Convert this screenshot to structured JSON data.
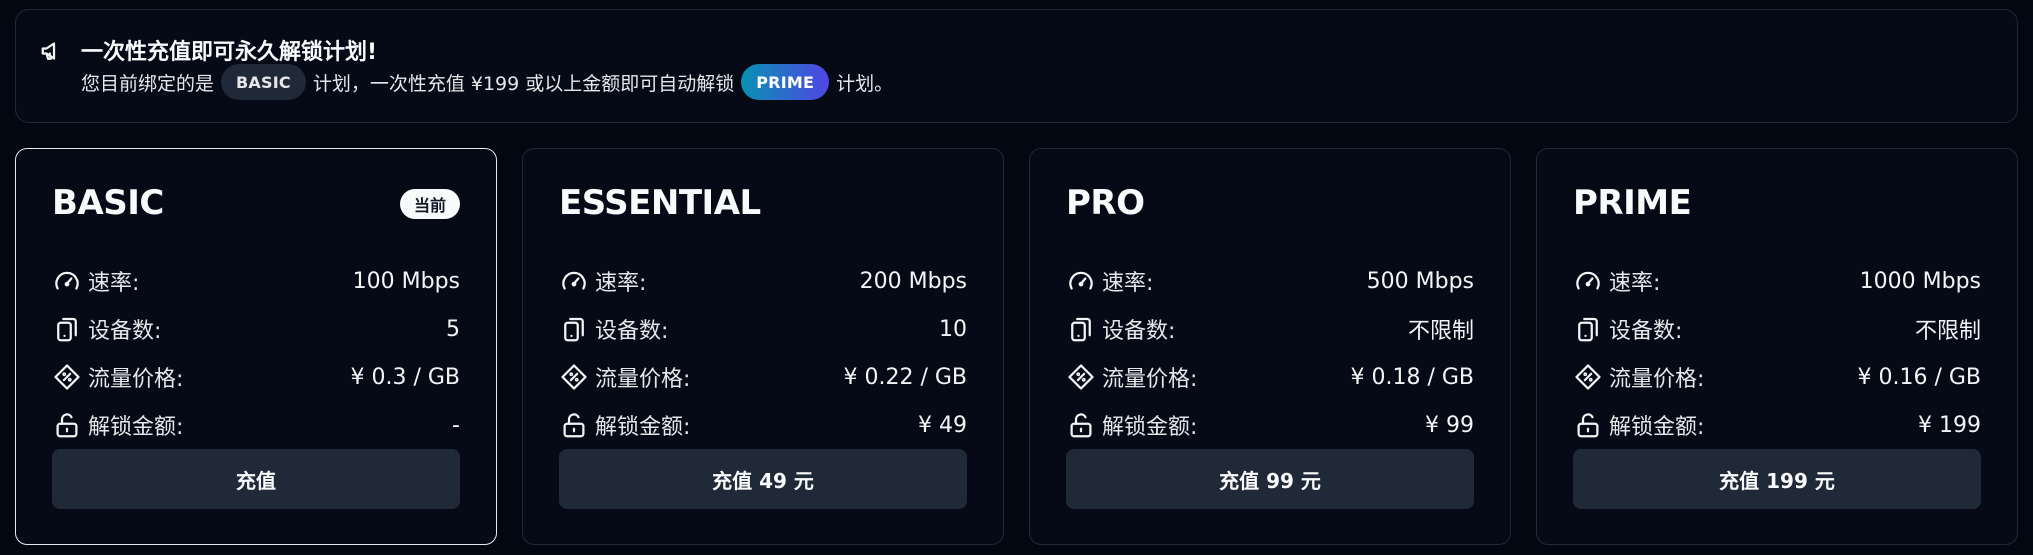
{
  "notice": {
    "title": "一次性充值即可永久解锁计划!",
    "line_prefix": "您目前绑定的是",
    "current_plan_badge": "BASIC",
    "line_middle": "计划，一次性充值 ¥199 或以上金额即可自动解锁",
    "target_plan_badge": "PRIME",
    "line_suffix": "计划。",
    "icon": "megaphone-icon"
  },
  "labels": {
    "speed": "速率:",
    "devices": "设备数:",
    "traffic_price": "流量价格:",
    "unlock_amount": "解锁金额:",
    "current_badge": "当前"
  },
  "icons": {
    "speed": "speedometer-icon",
    "devices": "device-icon",
    "traffic_price": "price-tag-icon",
    "unlock_amount": "unlock-icon"
  },
  "plans": [
    {
      "name": "BASIC",
      "speed": "100 Mbps",
      "devices": "5",
      "traffic_price": "¥ 0.3 / GB",
      "unlock_amount": "-",
      "button": "充值",
      "current": true
    },
    {
      "name": "ESSENTIAL",
      "speed": "200 Mbps",
      "devices": "10",
      "traffic_price": "¥ 0.22 / GB",
      "unlock_amount": "¥ 49",
      "button": "充值 49 元",
      "current": false
    },
    {
      "name": "PRO",
      "speed": "500 Mbps",
      "devices": "不限制",
      "traffic_price": "¥ 0.18 / GB",
      "unlock_amount": "¥ 99",
      "button": "充值 99 元",
      "current": false
    },
    {
      "name": "PRIME",
      "speed": "1000 Mbps",
      "devices": "不限制",
      "traffic_price": "¥ 0.16 / GB",
      "unlock_amount": "¥ 199",
      "button": "充值 199 元",
      "current": false
    }
  ],
  "colors": {
    "background": "#030712",
    "card_border": "#1f2937",
    "current_border": "#e5e7eb",
    "button_bg": "#1f2937",
    "prime_gradient_start": "#0891b2",
    "prime_gradient_end": "#4f46e5"
  }
}
